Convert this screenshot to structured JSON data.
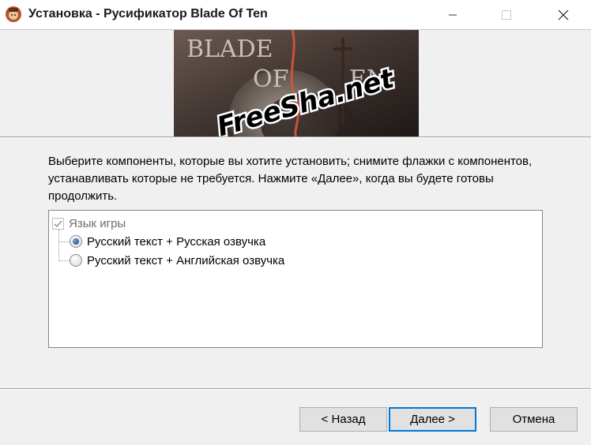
{
  "window": {
    "title": "Установка - Русификатор Blade Of Ten",
    "icons": {
      "app": "setup-app-icon",
      "minimize": "minimize-icon",
      "maximize": "maximize-icon",
      "close": "close-icon"
    }
  },
  "banner": {
    "game_logo_left": "BLADE",
    "game_logo_of": "OF",
    "game_logo_right": "EN",
    "watermark": "FreeSha.net"
  },
  "description": "Выберите компоненты, которые вы хотите установить; снимите флажки с компонентов, устанавливать которые не требуется. Нажмите «Далее», когда вы будете готовы продолжить.",
  "components": {
    "group_label": "Язык игры",
    "group_checked": true,
    "options": [
      {
        "label": "Русский текст + Русская озвучка",
        "selected": true
      },
      {
        "label": "Русский текст + Английская озвучка",
        "selected": false
      }
    ]
  },
  "buttons": {
    "back": "< Назад",
    "next": "Далее >",
    "cancel": "Отмена"
  },
  "colors": {
    "accent": "#0078d7",
    "window_bg": "#f0f0f0"
  }
}
